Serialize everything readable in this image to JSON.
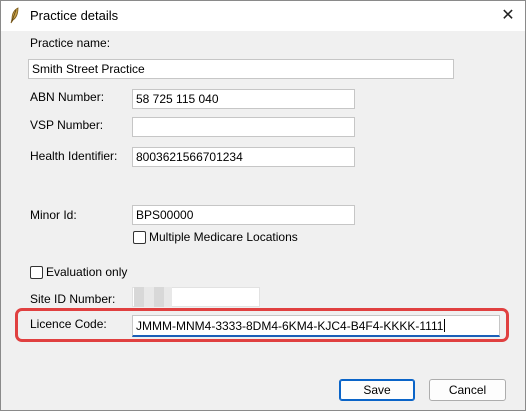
{
  "window": {
    "title": "Practice details",
    "close_glyph": "✕"
  },
  "form": {
    "practice_name_label": "Practice name:",
    "practice_name_value": "Smith Street Practice",
    "abn_label": "ABN Number:",
    "abn_value": "58 725 115 040",
    "vsp_label": "VSP Number:",
    "vsp_value": "",
    "health_id_label": "Health Identifier:",
    "health_id_value": "8003621566701234",
    "minor_id_label": "Minor Id:",
    "minor_id_value": "BPS00000",
    "multiple_medicare_label": "Multiple Medicare Locations",
    "evaluation_only_label": "Evaluation only",
    "site_id_label": "Site ID Number:",
    "licence_code_label": "Licence Code:",
    "licence_code_value": "JMMM-MNM4-3333-8DM4-6KM4-KJC4-B4F4-KKKK-1111"
  },
  "buttons": {
    "save": "Save",
    "cancel": "Cancel"
  },
  "colors": {
    "highlight": "#e04040",
    "focus_accent": "#1b5fb8",
    "default_button_border": "#0a64c8"
  },
  "icons": {
    "app": "feather-quill-icon",
    "close": "close-icon"
  }
}
